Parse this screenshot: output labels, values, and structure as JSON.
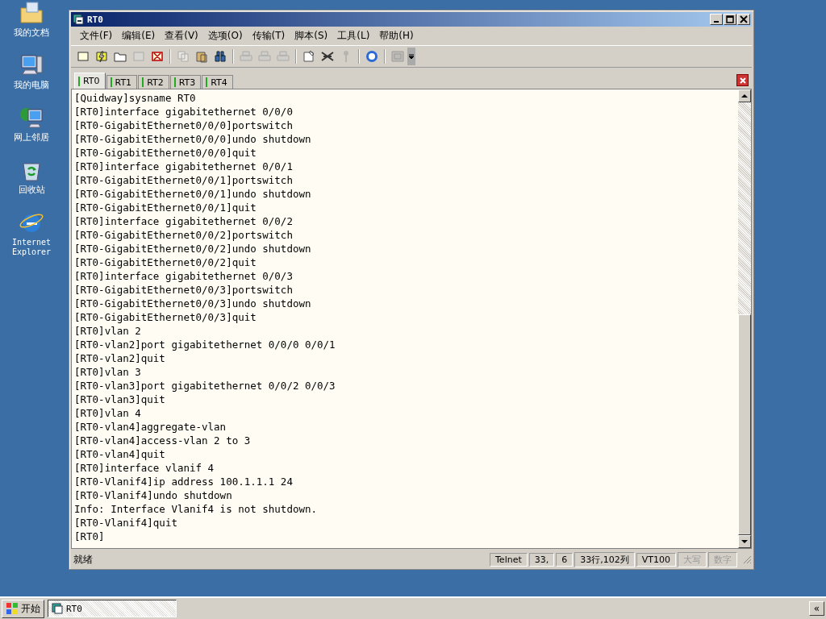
{
  "desktop_icons": [
    {
      "label": "我的文档",
      "kind": "folder"
    },
    {
      "label": "我的电脑",
      "kind": "computer"
    },
    {
      "label": "网上邻居",
      "kind": "network"
    },
    {
      "label": "回收站",
      "kind": "recycle"
    },
    {
      "label": "Internet Explorer",
      "kind": "browser"
    }
  ],
  "window": {
    "title": "RT0"
  },
  "menu": [
    "文件(F)",
    "编辑(E)",
    "查看(V)",
    "选项(O)",
    "传输(T)",
    "脚本(S)",
    "工具(L)",
    "帮助(H)"
  ],
  "tabs": [
    {
      "label": "RT0",
      "selected": true
    },
    {
      "label": "RT1",
      "selected": false
    },
    {
      "label": "RT2",
      "selected": false
    },
    {
      "label": "RT3",
      "selected": false
    },
    {
      "label": "RT4",
      "selected": false
    }
  ],
  "terminal_lines": [
    "[Quidway]sysname RT0",
    "[RT0]interface gigabitethernet 0/0/0",
    "[RT0-GigabitEthernet0/0/0]portswitch",
    "[RT0-GigabitEthernet0/0/0]undo shutdown",
    "[RT0-GigabitEthernet0/0/0]quit",
    "[RT0]interface gigabitethernet 0/0/1",
    "[RT0-GigabitEthernet0/0/1]portswitch",
    "[RT0-GigabitEthernet0/0/1]undo shutdown",
    "[RT0-GigabitEthernet0/0/1]quit",
    "[RT0]interface gigabitethernet 0/0/2",
    "[RT0-GigabitEthernet0/0/2]portswitch",
    "[RT0-GigabitEthernet0/0/2]undo shutdown",
    "[RT0-GigabitEthernet0/0/2]quit",
    "[RT0]interface gigabitethernet 0/0/3",
    "[RT0-GigabitEthernet0/0/3]portswitch",
    "[RT0-GigabitEthernet0/0/3]undo shutdown",
    "[RT0-GigabitEthernet0/0/3]quit",
    "[RT0]vlan 2",
    "[RT0-vlan2]port gigabitethernet 0/0/0 0/0/1",
    "[RT0-vlan2]quit",
    "[RT0]vlan 3",
    "[RT0-vlan3]port gigabitethernet 0/0/2 0/0/3",
    "[RT0-vlan3]quit",
    "[RT0]vlan 4",
    "[RT0-vlan4]aggregate-vlan",
    "[RT0-vlan4]access-vlan 2 to 3",
    "[RT0-vlan4]quit",
    "[RT0]interface vlanif 4",
    "[RT0-Vlanif4]ip address 100.1.1.1 24",
    "[RT0-Vlanif4]undo shutdown",
    "Info: Interface Vlanif4 is not shutdown.",
    "[RT0-Vlanif4]quit",
    "[RT0]"
  ],
  "status_bar": {
    "message": "就绪",
    "panes": [
      {
        "text": "Telnet",
        "disabled": false
      },
      {
        "text": "33,",
        "disabled": false
      },
      {
        "text": "6",
        "disabled": false
      },
      {
        "text": "33行,102列",
        "disabled": false
      },
      {
        "text": "VT100",
        "disabled": false
      },
      {
        "text": "大写",
        "disabled": true
      },
      {
        "text": "数字",
        "disabled": true
      }
    ]
  },
  "taskbar": {
    "start": "开始",
    "tasks": [
      {
        "label": "RT0",
        "selected": false
      }
    ],
    "tray_button": "«"
  }
}
